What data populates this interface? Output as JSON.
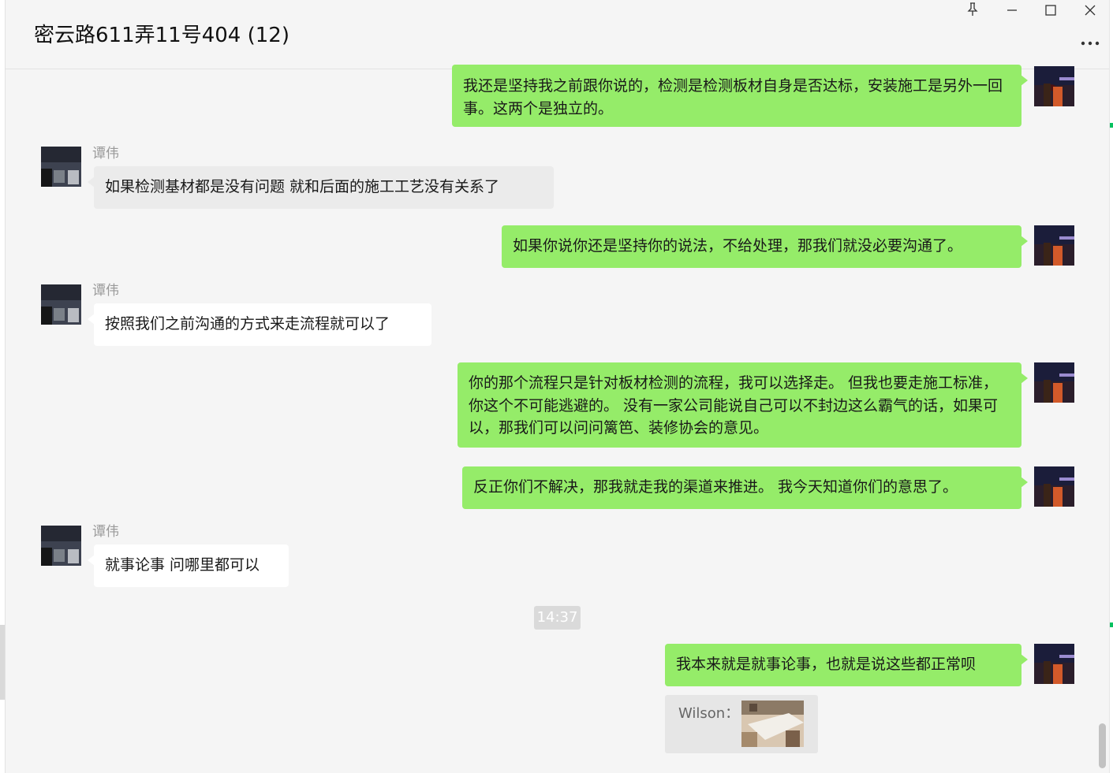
{
  "window": {
    "title": "密云路611弄11号404 (12)",
    "controls": [
      "pin-icon",
      "minimize-icon",
      "maximize-icon",
      "close-icon",
      "more-icon"
    ]
  },
  "colors": {
    "self_bubble": "#95ec69",
    "other_bubble": "#ebebeb",
    "background": "#f5f5f5",
    "accent_green": "#07c160"
  },
  "messages": [
    {
      "from": "self",
      "text": "我还是坚持我之前跟你说的，检测是检测板材自身是否达标，安装施工是另外一回事。这两个是独立的。"
    },
    {
      "from": "other",
      "sender": "谭伟",
      "text": "如果检测基材都是没有问题 就和后面的施工工艺没有关系了"
    },
    {
      "from": "self",
      "text": "如果你说你还是坚持你的说法，不给处理，那我们就没必要沟通了。"
    },
    {
      "from": "other",
      "sender": "谭伟",
      "text": "按照我们之前沟通的方式来走流程就可以了"
    },
    {
      "from": "self",
      "text": "你的那个流程只是针对板材检测的流程，我可以选择走。 但我也要走施工标准，你这个不可能逃避的。 没有一家公司能说自己可以不封边这么霸气的话，如果可以，那我们可以问问篱笆、装修协会的意见。"
    },
    {
      "from": "self",
      "text": "反正你们不解决，那我就走我的渠道来推进。 我今天知道你们的意思了。"
    },
    {
      "from": "other",
      "sender": "谭伟",
      "text": "就事论事 问哪里都可以"
    },
    {
      "type": "timestamp",
      "text": "14:37"
    },
    {
      "from": "self",
      "text": "我本来就是就事论事，也就是说这些都正常呗"
    },
    {
      "type": "quote",
      "label": "Wilson：",
      "thumbnail": "photo-thumbnail"
    }
  ]
}
